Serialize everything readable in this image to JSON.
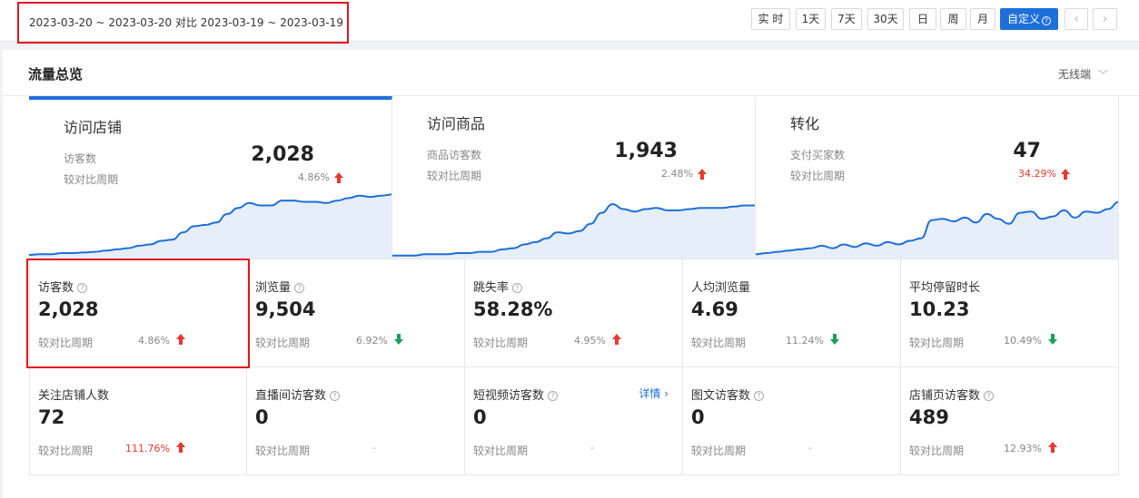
{
  "date_range": "2023-03-20 ~ 2023-03-20 对比 2023-03-19 ~ 2023-03-19",
  "segments": [
    "实 时",
    "1天",
    "7天",
    "30天",
    "日",
    "周",
    "月",
    "自定义"
  ],
  "nav": {
    "prev": "‹",
    "next": "›"
  },
  "panel": {
    "title": "流量总览",
    "device": "无线端"
  },
  "cards": [
    {
      "title": "访问店铺",
      "label": "访客数",
      "value": "2,028",
      "compare": "较对比周期",
      "pct": "4.86%",
      "trend": "up",
      "series": [
        3,
        4,
        4,
        6,
        6,
        7,
        8,
        10,
        12,
        14,
        18,
        20,
        26,
        28,
        40,
        50,
        52,
        56,
        70,
        80,
        88,
        84,
        84,
        92,
        92,
        90,
        90,
        88,
        92,
        96,
        100,
        98,
        100,
        102
      ]
    },
    {
      "title": "访问商品",
      "label": "商品访客数",
      "value": "1,943",
      "compare": "较对比周期",
      "pct": "2.48%",
      "trend": "up",
      "series": [
        2,
        2,
        2,
        4,
        4,
        4,
        6,
        6,
        8,
        8,
        12,
        14,
        20,
        24,
        30,
        40,
        38,
        42,
        54,
        72,
        86,
        78,
        74,
        78,
        80,
        76,
        76,
        78,
        80,
        80,
        80,
        82,
        84,
        84
      ]
    },
    {
      "title": "转化",
      "label": "支付买家数",
      "value": "47",
      "compare": "较对比周期",
      "pct": "34.29%",
      "trend": "up",
      "pct_red": true,
      "series": [
        4,
        6,
        8,
        10,
        12,
        14,
        18,
        14,
        20,
        16,
        22,
        18,
        24,
        20,
        26,
        30,
        60,
        62,
        58,
        64,
        56,
        70,
        62,
        54,
        72,
        74,
        62,
        66,
        76,
        64,
        74,
        72,
        78,
        90
      ]
    }
  ],
  "metrics": [
    {
      "label": "访客数",
      "value": "2,028",
      "compare": "较对比周期",
      "pct": "4.86%",
      "trend": "up",
      "help": true
    },
    {
      "label": "浏览量",
      "value": "9,504",
      "compare": "较对比周期",
      "pct": "6.92%",
      "trend": "down",
      "help": true
    },
    {
      "label": "跳失率",
      "value": "58.28%",
      "compare": "较对比周期",
      "pct": "4.95%",
      "trend": "up",
      "help": true
    },
    {
      "label": "人均浏览量",
      "value": "4.69",
      "compare": "较对比周期",
      "pct": "11.24%",
      "trend": "down",
      "help": false
    },
    {
      "label": "平均停留时长",
      "value": "10.23",
      "compare": "较对比周期",
      "pct": "10.49%",
      "trend": "down",
      "help": false
    },
    {
      "label": "关注店铺人数",
      "value": "72",
      "compare": "较对比周期",
      "pct": "111.76%",
      "trend": "up",
      "help": false,
      "pct_red": true
    },
    {
      "label": "直播间访客数",
      "value": "0",
      "compare": "较对比周期",
      "pct": "-",
      "trend": "none",
      "help": true
    },
    {
      "label": "短视频访客数",
      "value": "0",
      "compare": "较对比周期",
      "pct": "-",
      "trend": "none",
      "help": true,
      "detail": "详情 ›"
    },
    {
      "label": "图文访客数",
      "value": "0",
      "compare": "较对比周期",
      "pct": "-",
      "trend": "none",
      "help": true
    },
    {
      "label": "店铺页访客数",
      "value": "489",
      "compare": "较对比周期",
      "pct": "12.93%",
      "trend": "up",
      "help": true
    }
  ],
  "colors": {
    "accent": "#1e6fd9",
    "up": "#e8382f",
    "down": "#1aa05a",
    "highlight": "#e0161d"
  }
}
